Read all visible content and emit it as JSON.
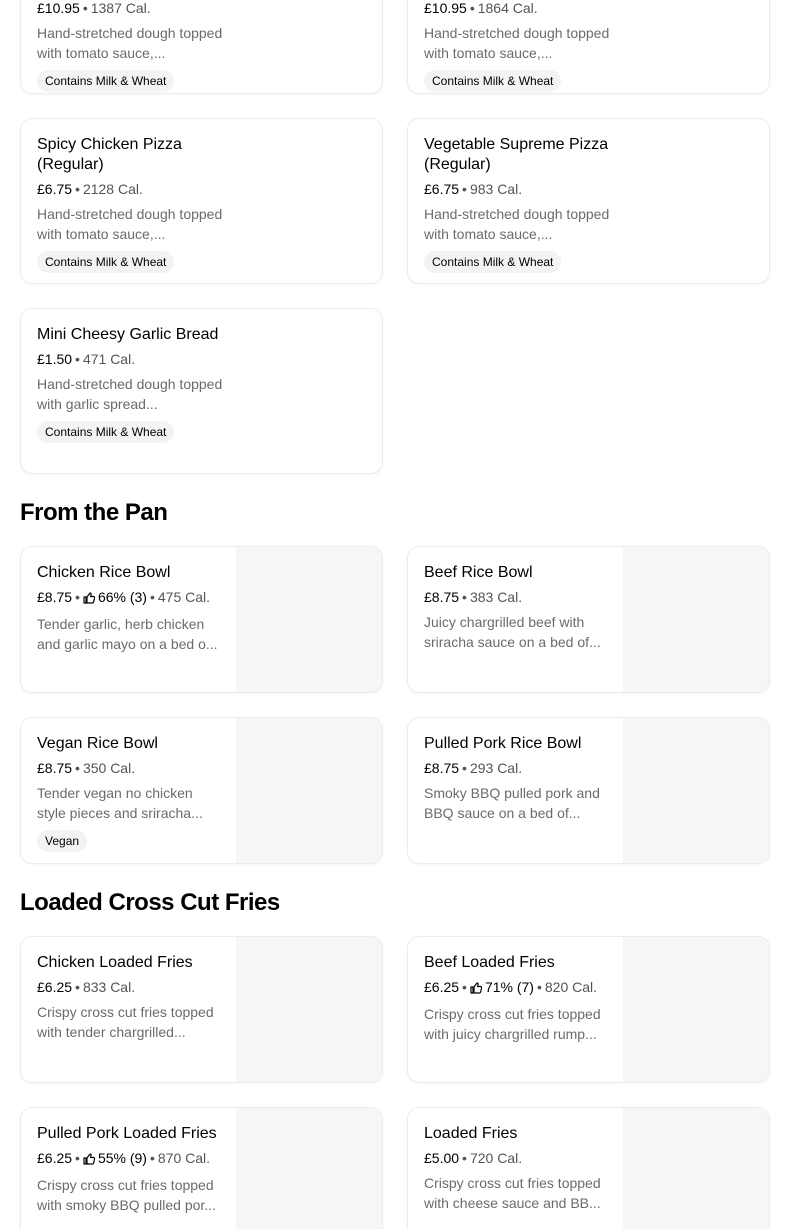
{
  "top_row": [
    {
      "price": "£10.95",
      "calories": "1387 Cal.",
      "desc": "Hand-stretched dough topped with tomato sauce,...",
      "badge": "Contains Milk & Wheat"
    },
    {
      "price": "£10.95",
      "calories": "1864 Cal.",
      "desc": "Hand-stretched dough topped with tomato sauce,...",
      "badge": "Contains Milk & Wheat"
    }
  ],
  "pizza_items": [
    {
      "title": "Spicy Chicken Pizza (Regular)",
      "price": "£6.75",
      "calories": "2128 Cal.",
      "desc": "Hand-stretched dough topped with tomato sauce,...",
      "badge": "Contains Milk & Wheat"
    },
    {
      "title": "Vegetable Supreme Pizza (Regular)",
      "price": "£6.75",
      "calories": "983 Cal.",
      "desc": "Hand-stretched dough topped with tomato sauce,...",
      "badge": "Contains Milk & Wheat"
    },
    {
      "title": "Mini Cheesy Garlic Bread",
      "price": "£1.50",
      "calories": "471 Cal.",
      "desc": "Hand-stretched dough topped with garlic spread...",
      "badge": "Contains Milk & Wheat"
    }
  ],
  "sections": {
    "from_the_pan": "From the Pan",
    "loaded_fries": "Loaded Cross Cut Fries"
  },
  "pan_items": [
    {
      "title": "Chicken Rice Bowl",
      "price": "£8.75",
      "rating": "66% (3)",
      "calories": "475 Cal.",
      "desc": "Tender garlic, herb chicken and garlic mayo on a bed o...",
      "badge": ""
    },
    {
      "title": "Beef Rice Bowl",
      "price": "£8.75",
      "rating": "",
      "calories": "383 Cal.",
      "desc": "Juicy chargrilled beef with sriracha sauce on a bed of...",
      "badge": ""
    },
    {
      "title": "Vegan Rice Bowl",
      "price": "£8.75",
      "rating": "",
      "calories": "350 Cal.",
      "desc": "Tender vegan no chicken style pieces and sriracha...",
      "badge": "Vegan"
    },
    {
      "title": "Pulled Pork Rice Bowl",
      "price": "£8.75",
      "rating": "",
      "calories": "293 Cal.",
      "desc": "Smoky BBQ pulled pork and BBQ sauce on a bed of...",
      "badge": ""
    }
  ],
  "fries_items": [
    {
      "title": "Chicken Loaded Fries",
      "price": "£6.25",
      "rating": "",
      "calories": "833 Cal.",
      "desc": "Crispy cross cut fries topped with tender chargrilled...",
      "badge": ""
    },
    {
      "title": "Beef Loaded Fries",
      "price": "£6.25",
      "rating": "71% (7)",
      "calories": "820 Cal.",
      "desc": "Crispy cross cut fries topped with juicy chargrilled rump...",
      "badge": ""
    },
    {
      "title": "Pulled Pork Loaded Fries",
      "price": "£6.25",
      "rating": "55% (9)",
      "calories": "870 Cal.",
      "desc": "Crispy cross cut fries topped with smoky BBQ pulled por...",
      "badge": ""
    },
    {
      "title": "Loaded Fries",
      "price": "£5.00",
      "rating": "",
      "calories": "720 Cal.",
      "desc": "Crispy cross cut fries topped with cheese sauce and BB...",
      "badge": ""
    }
  ],
  "separator": "•",
  "icons": {
    "rating": "thumbs-up-icon"
  }
}
